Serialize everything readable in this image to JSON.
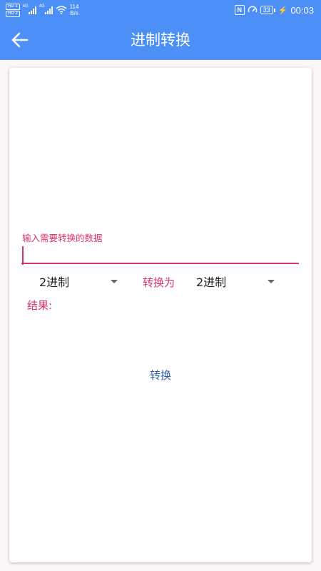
{
  "status_bar": {
    "hd1": "HD 1",
    "hd2": "HD 2",
    "net1": "4G",
    "net2": "4G",
    "speed_value": "114",
    "speed_unit": "B/s",
    "nfc": "N",
    "battery": "33",
    "time": "00:03"
  },
  "app_bar": {
    "title": "进制转换"
  },
  "form": {
    "input_label": "输入需要转换的数据",
    "input_value": "",
    "from_base": "2进制",
    "convert_to_label": "转换为",
    "to_base": "2进制",
    "result_label": "结果:",
    "result_value": "",
    "convert_button": "转换"
  },
  "colors": {
    "primary": "#4c8ff7",
    "accent": "#d6336c",
    "button_text": "#2f5fa6"
  }
}
